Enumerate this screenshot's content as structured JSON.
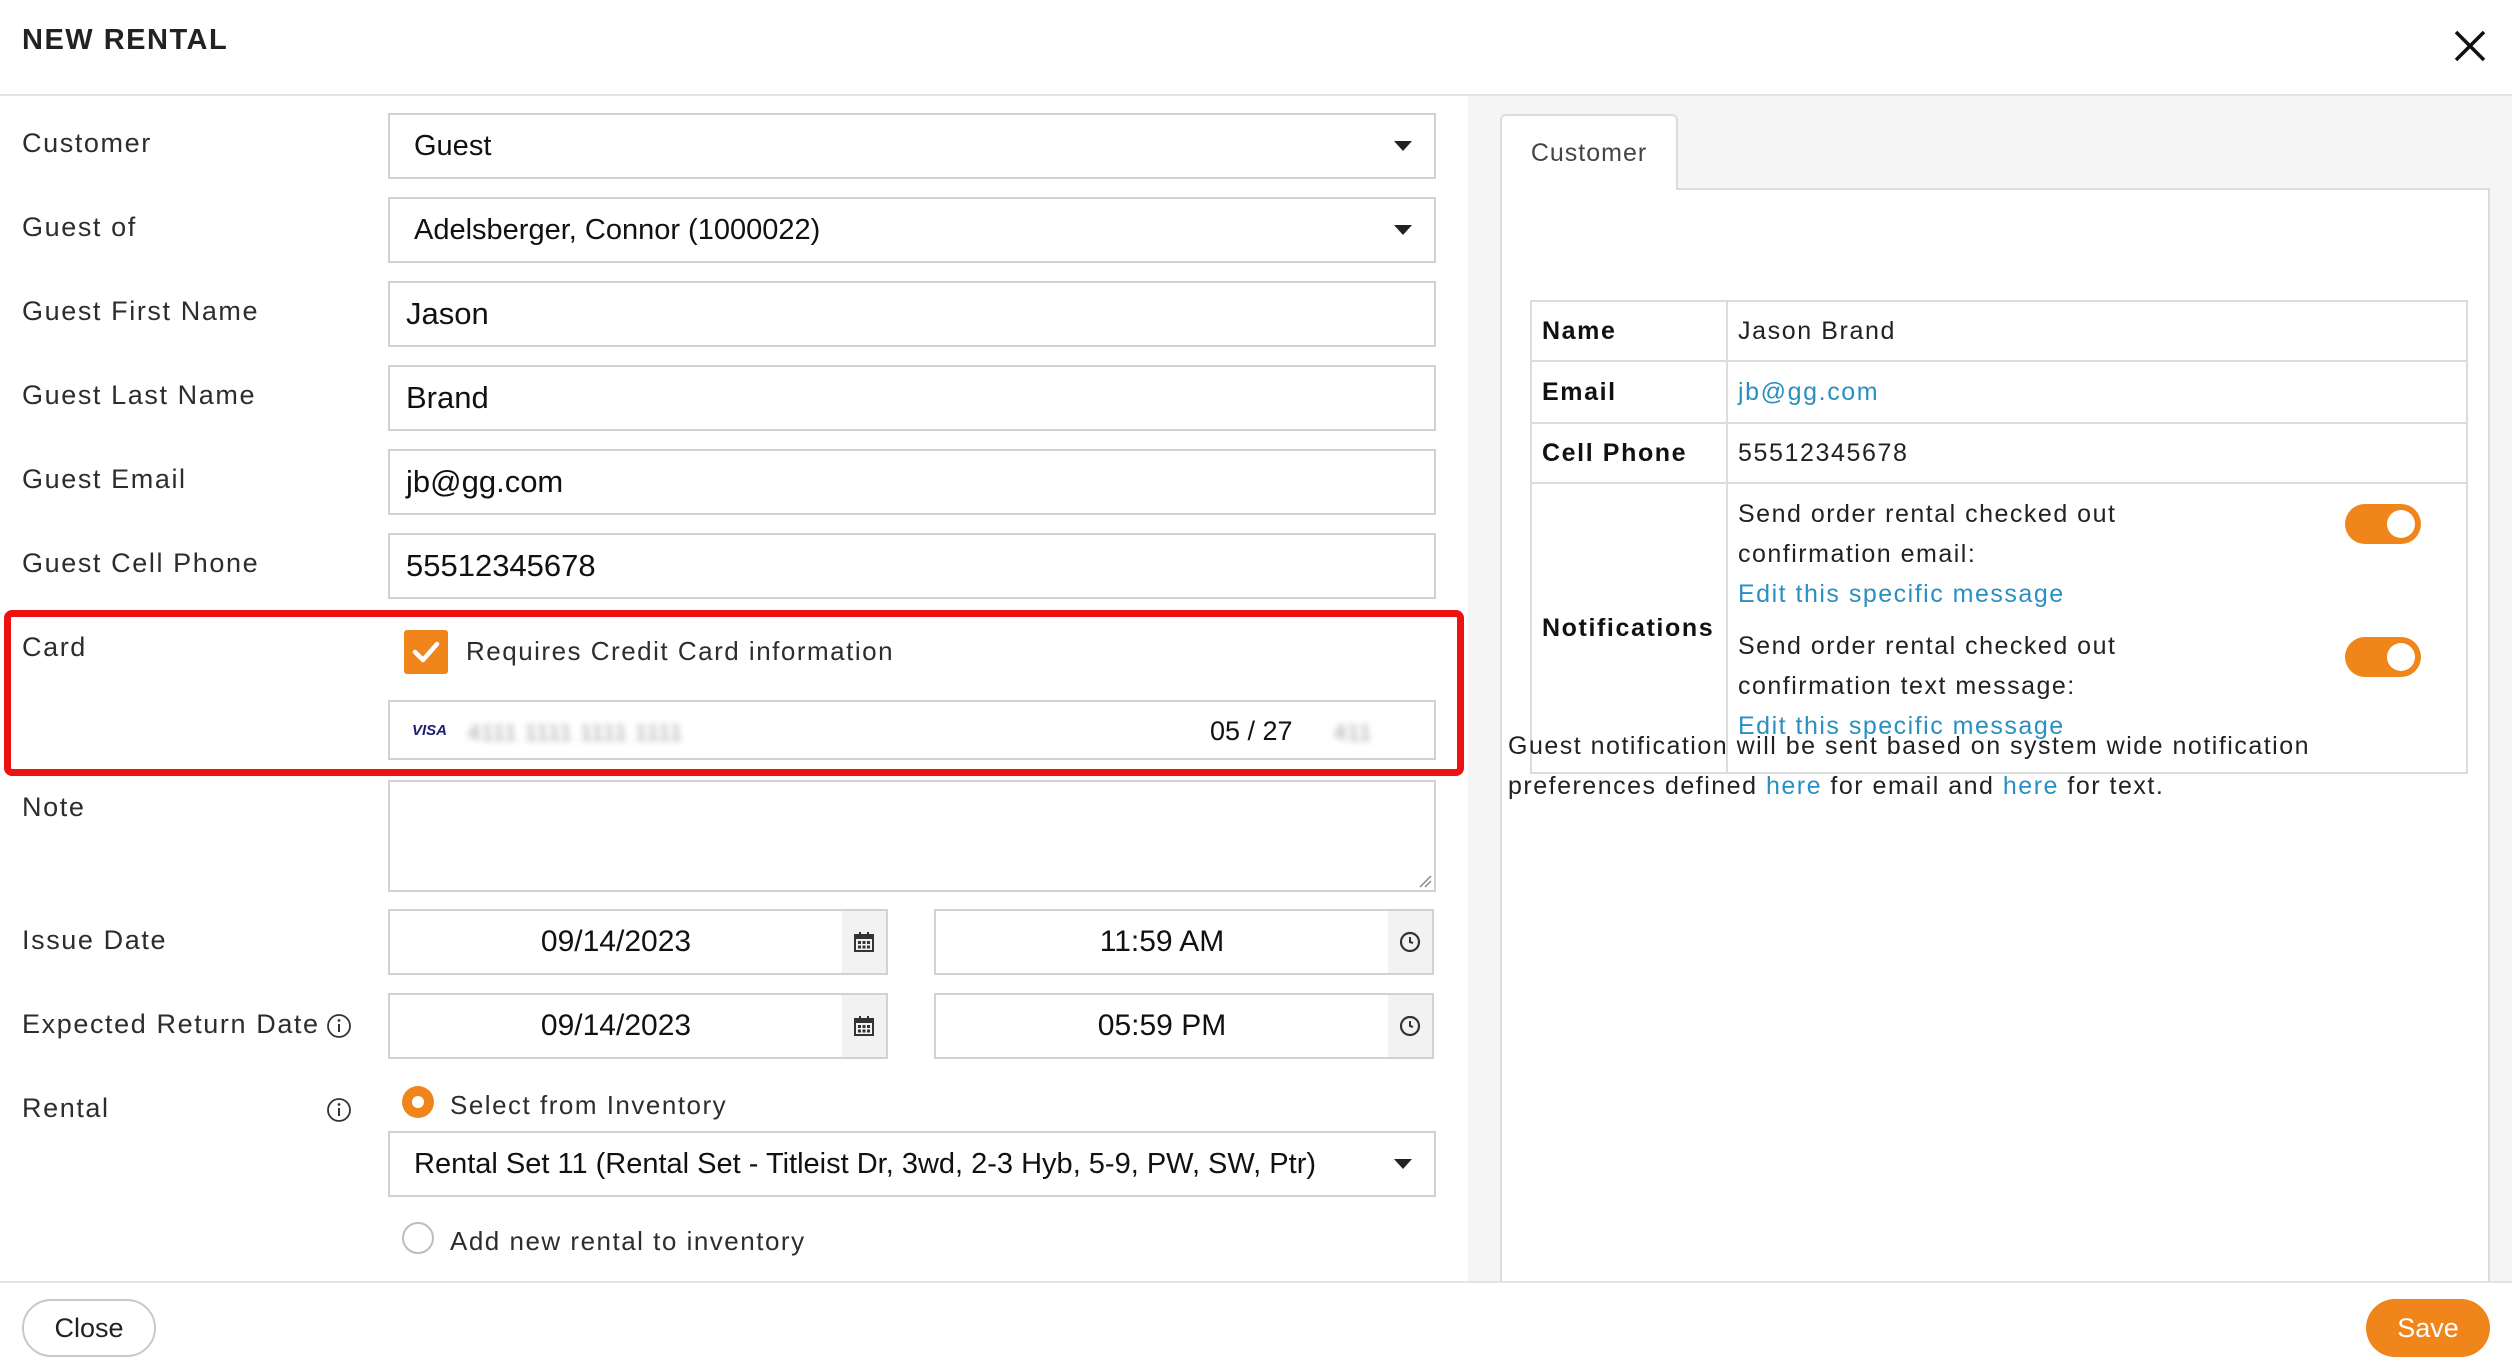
{
  "header": {
    "title": "NEW RENTAL"
  },
  "form": {
    "customer": {
      "label": "Customer",
      "value": "Guest"
    },
    "guest_of": {
      "label": "Guest of",
      "value": "Adelsberger, Connor (1000022)"
    },
    "first_name": {
      "label": "Guest First Name",
      "value": "Jason"
    },
    "last_name": {
      "label": "Guest Last Name",
      "value": "Brand"
    },
    "email": {
      "label": "Guest Email",
      "value": "jb@gg.com"
    },
    "cell_phone": {
      "label": "Guest Cell Phone",
      "value": "55512345678"
    },
    "card": {
      "label": "Card",
      "requires_label": "Requires Credit Card information",
      "requires_checked": true,
      "brand": "VISA",
      "number_masked": "4111 1111 1111 1111",
      "expiry": "05 / 27",
      "cvc_masked": "411"
    },
    "note": {
      "label": "Note",
      "value": ""
    },
    "issue": {
      "label": "Issue Date",
      "date": "09/14/2023",
      "time": "11:59 AM"
    },
    "return": {
      "label": "Expected Return Date",
      "date": "09/14/2023",
      "time": "05:59 PM"
    },
    "rental": {
      "label": "Rental",
      "option_inventory": "Select from Inventory",
      "inventory_value": "Rental Set 11 (Rental Set - Titleist Dr, 3wd, 2-3 Hyb, 5-9, PW, SW, Ptr)",
      "option_new": "Add new rental to inventory"
    }
  },
  "sidepanel": {
    "tab": "Customer",
    "rows": {
      "name": {
        "label": "Name",
        "value": "Jason Brand"
      },
      "email": {
        "label": "Email",
        "value": "jb@gg.com"
      },
      "cell": {
        "label": "Cell Phone",
        "value": "55512345678"
      },
      "notifications": {
        "label": "Notifications",
        "email_line1": "Send order rental checked out",
        "email_line2": "confirmation email:",
        "email_link": "Edit this specific message",
        "text_line1": "Send order rental checked out",
        "text_line2": "confirmation text message:",
        "text_link": "Edit this specific message",
        "email_enabled": true,
        "text_enabled": true
      }
    },
    "guest_note": {
      "part1": "Guest notification will be sent based on system wide notification preferences defined ",
      "link1": "here",
      "part2": " for email and ",
      "link2": "here",
      "part3": " for text."
    }
  },
  "footer": {
    "close_label": "Close",
    "save_label": "Save"
  },
  "colors": {
    "accent": "#f0851b",
    "highlight": "#ee1111",
    "link": "#2a8fc1"
  },
  "icons": [
    "close-icon",
    "chevron-down-icon",
    "checkmark-icon",
    "visa-icon",
    "calendar-icon",
    "clock-icon",
    "info-icon",
    "resize-handle-icon"
  ]
}
